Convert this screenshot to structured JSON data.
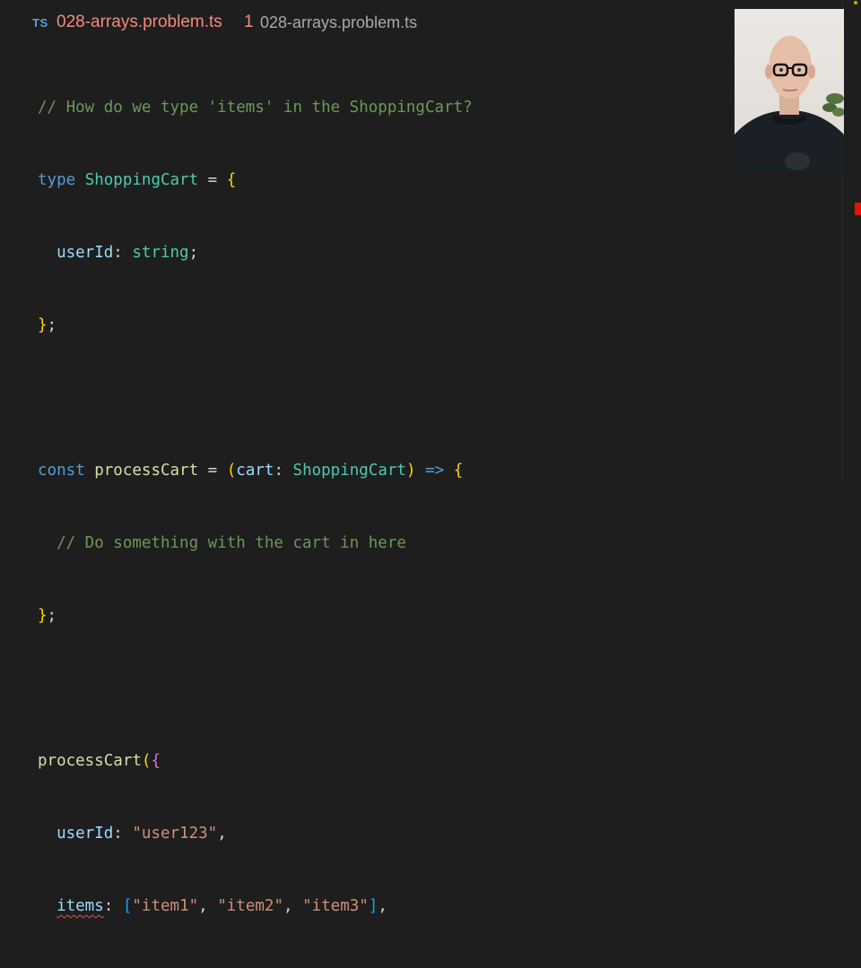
{
  "tab": {
    "lang_badge": "TS",
    "filename": "028-arrays.problem.ts",
    "problem_count": "1",
    "description": "028-arrays.problem.ts"
  },
  "code": {
    "l1": "// How do we type 'items' in the ShoppingCart?",
    "l2_kw": "type",
    "l2_type": "ShoppingCart",
    "l2_eq": " = ",
    "l2_brace": "{",
    "l3_prop": "userId",
    "l3_colon": ": ",
    "l3_type": "string",
    "l3_semi": ";",
    "l4_brace": "}",
    "l4_semi": ";",
    "l6_kw": "const",
    "l6_fn": "processCart",
    "l6_eq": " = ",
    "l6_paren_open": "(",
    "l6_param": "cart",
    "l6_colon": ": ",
    "l6_type": "ShoppingCart",
    "l6_paren_close": ")",
    "l6_arrow": "=>",
    "l6_brace": "{",
    "l7": "// Do something with the cart in here",
    "l8_brace": "}",
    "l8_semi": ";",
    "l10_fn": "processCart",
    "l10_paren": "(",
    "l10_brace": "{",
    "l11_prop": "userId",
    "l11_colon": ": ",
    "l11_value": "\"user123\"",
    "l11_comma": ",",
    "l12_prop": "items",
    "l12_colon": ": ",
    "l12_bracket_open": "[",
    "l12_v1": "\"item1\"",
    "l12_v2": "\"item2\"",
    "l12_v3": "\"item3\"",
    "l12_sep": ", ",
    "l12_bracket_close": "]",
    "l12_comma": ",",
    "l13_brace": "}",
    "l13_paren": ")",
    "l13_semi": ";"
  },
  "colors": {
    "background": "#1e1e1e",
    "comment": "#6a9955",
    "keyword": "#569cd6",
    "type": "#4ec9b0",
    "property": "#9cdcfe",
    "function": "#dcdcaa",
    "string": "#ce9178",
    "error": "#f14c4c",
    "tab_error_text": "#f28b82"
  },
  "icons": {
    "file_type": "typescript-icon",
    "error_marker": "error-marker",
    "webcam": "webcam-overlay"
  }
}
